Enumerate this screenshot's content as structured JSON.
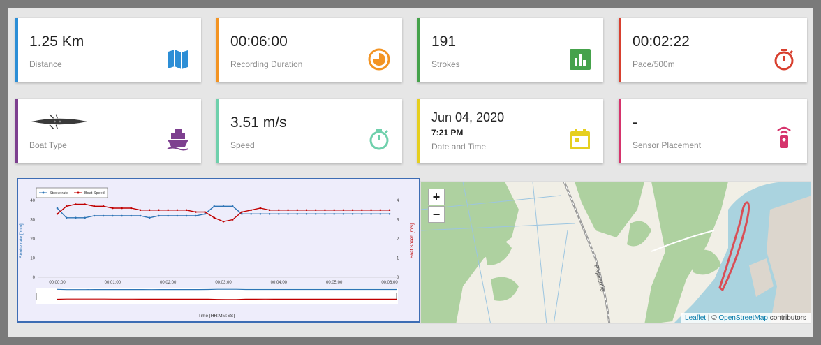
{
  "cards": [
    {
      "value": "1.25 Km",
      "label": "Distance",
      "color": "#2c8ed6",
      "icon": "map-icon"
    },
    {
      "value": "00:06:00",
      "label": "Recording Duration",
      "color": "#f39423",
      "icon": "pie-timer-icon"
    },
    {
      "value": "191",
      "label": "Strokes",
      "color": "#45a24b",
      "icon": "bar-chart-icon"
    },
    {
      "value": "00:02:22",
      "label": "Pace/500m",
      "color": "#d8402f",
      "icon": "stopwatch-icon"
    },
    {
      "value": "",
      "label": "Boat Type",
      "color": "#7d3f8f",
      "icon": "ship-icon"
    },
    {
      "value": "3.51 m/s",
      "label": "Speed",
      "color": "#6fd0ac",
      "icon": "stopwatch-icon"
    },
    {
      "value": "Jun 04, 2020",
      "sub": "7:21 PM",
      "label": "Date and Time",
      "color": "#e6cf1f",
      "icon": "calendar-icon"
    },
    {
      "value": "-",
      "label": "Sensor Placement",
      "color": "#d6336c",
      "icon": "remote-sensor-icon"
    }
  ],
  "chart_data": {
    "type": "line",
    "xlabel": "Time [HH:MM:SS]",
    "ylabel_left": "Stroke rate [/min]",
    "ylabel_right": "Boat Speed [m/s]",
    "ylim_left": [
      0,
      40
    ],
    "ylim_right": [
      0,
      4
    ],
    "x_ticks": [
      "00:00:00",
      "00:01:00",
      "00:02:00",
      "00:03:00",
      "00:04:00",
      "00:05:00",
      "00:06:00"
    ],
    "y_ticks_left": [
      0,
      10,
      20,
      30,
      40
    ],
    "y_ticks_right": [
      0,
      1,
      2,
      3,
      4
    ],
    "legend_position": "top-left",
    "x": [
      0,
      10,
      20,
      30,
      40,
      50,
      60,
      70,
      80,
      90,
      100,
      110,
      120,
      130,
      140,
      150,
      160,
      170,
      180,
      190,
      200,
      210,
      220,
      230,
      240,
      250,
      260,
      270,
      280,
      290,
      300,
      310,
      320,
      330,
      340,
      350,
      360
    ],
    "series": [
      {
        "name": "Stroke rate",
        "color": "#2e75b6",
        "axis": "left",
        "values": [
          36,
          31,
          31,
          31,
          32,
          32,
          32,
          32,
          32,
          32,
          31,
          32,
          32,
          32,
          32,
          32,
          33,
          37,
          37,
          37,
          33,
          33,
          33,
          33,
          33,
          33,
          33,
          33,
          33,
          33,
          33,
          33,
          33,
          33,
          33,
          33,
          33
        ]
      },
      {
        "name": "Boat Speed",
        "color": "#c00000",
        "axis": "right",
        "values": [
          3.3,
          3.7,
          3.8,
          3.8,
          3.7,
          3.7,
          3.6,
          3.6,
          3.6,
          3.5,
          3.5,
          3.5,
          3.5,
          3.5,
          3.5,
          3.4,
          3.4,
          3.1,
          2.9,
          3.0,
          3.4,
          3.5,
          3.6,
          3.5,
          3.5,
          3.5,
          3.5,
          3.5,
          3.5,
          3.5,
          3.5,
          3.5,
          3.5,
          3.5,
          3.5,
          3.5,
          3.5
        ]
      }
    ]
  },
  "map": {
    "zoom_in": "+",
    "zoom_out": "−",
    "road_label": "Pajalantie",
    "attribution_leaflet": "Leaflet",
    "attribution_sep": " | © ",
    "attribution_osm": "OpenStreetMap",
    "attribution_tail": " contributors"
  }
}
